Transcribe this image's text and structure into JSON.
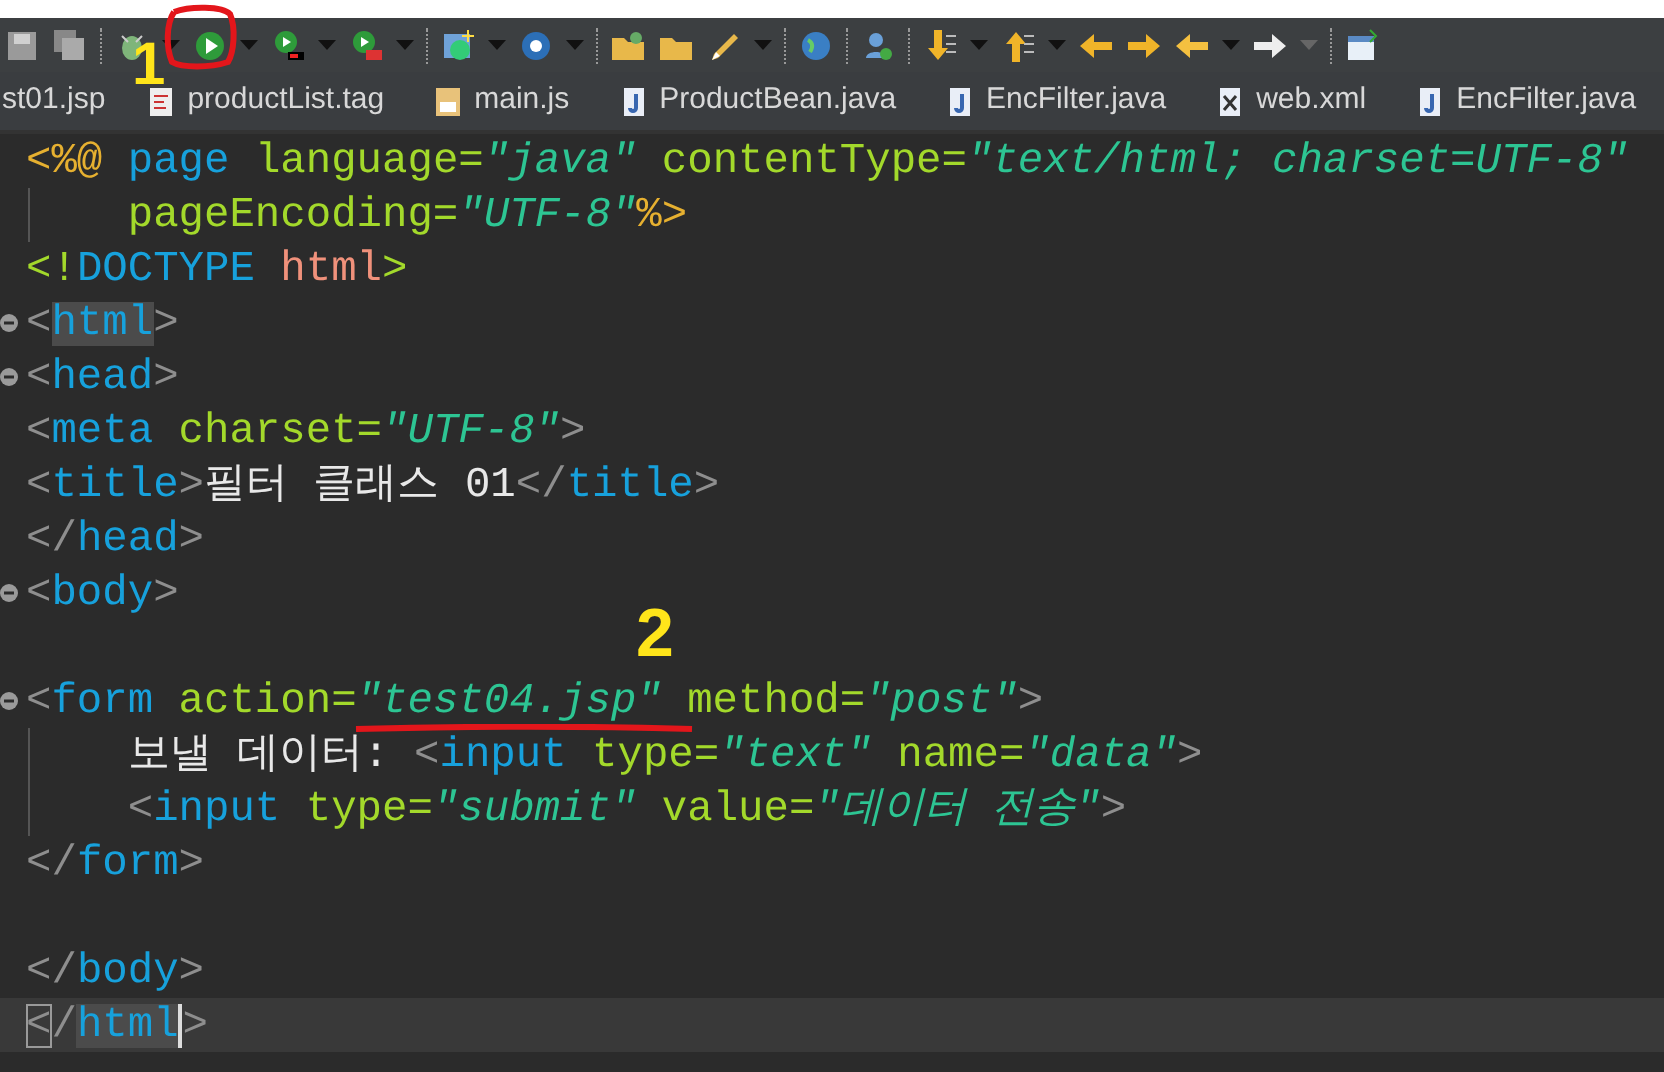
{
  "tabs": [
    {
      "label": "st01.jsp",
      "kind": "jsp"
    },
    {
      "label": "productList.tag",
      "kind": "tag"
    },
    {
      "label": "main.js",
      "kind": "js"
    },
    {
      "label": "ProductBean.java",
      "kind": "java"
    },
    {
      "label": "EncFilter.java",
      "kind": "java"
    },
    {
      "label": "web.xml",
      "kind": "xml"
    },
    {
      "label": "EncFilter.java",
      "kind": "java"
    }
  ],
  "editor": {
    "lines": [
      {
        "fold": false,
        "current": false,
        "tokens": [
          {
            "kind": "directive",
            "text": "<%@"
          },
          {
            "kind": "tag",
            "text": " page"
          },
          {
            "kind": "attr",
            "text": " language="
          },
          {
            "kind": "string",
            "text": "\"java\""
          },
          {
            "kind": "attr",
            "text": " contentType="
          },
          {
            "kind": "string",
            "text": "\"text/html; charset=UTF-8\""
          }
        ]
      },
      {
        "fold": false,
        "current": false,
        "tokens": [
          {
            "kind": "attr",
            "text": "    pageEncoding="
          },
          {
            "kind": "string",
            "text": "\"UTF-8\""
          },
          {
            "kind": "directive",
            "text": "%>"
          }
        ]
      },
      {
        "fold": false,
        "current": false,
        "tokens": [
          {
            "kind": "attr",
            "text": "<!"
          },
          {
            "kind": "tag",
            "text": "DOCTYPE"
          },
          {
            "kind": "root",
            "text": " html"
          },
          {
            "kind": "attr",
            "text": ">"
          }
        ]
      },
      {
        "fold": true,
        "current": false,
        "tokens": [
          {
            "kind": "punct",
            "text": "<"
          },
          {
            "kind": "tag",
            "text": "html",
            "highlighted": true
          },
          {
            "kind": "punct",
            "text": ">"
          }
        ]
      },
      {
        "fold": true,
        "current": false,
        "tokens": [
          {
            "kind": "punct",
            "text": "<"
          },
          {
            "kind": "tag",
            "text": "head"
          },
          {
            "kind": "punct",
            "text": ">"
          }
        ]
      },
      {
        "fold": false,
        "current": false,
        "tokens": [
          {
            "kind": "punct",
            "text": "<"
          },
          {
            "kind": "tag",
            "text": "meta"
          },
          {
            "kind": "attr",
            "text": " charset="
          },
          {
            "kind": "string",
            "text": "\"UTF-8\""
          },
          {
            "kind": "punct",
            "text": ">"
          }
        ]
      },
      {
        "fold": false,
        "current": false,
        "tokens": [
          {
            "kind": "punct",
            "text": "<"
          },
          {
            "kind": "tag",
            "text": "title"
          },
          {
            "kind": "punct",
            "text": ">"
          },
          {
            "kind": "text",
            "text": "필터 클래스 01"
          },
          {
            "kind": "punct",
            "text": "</"
          },
          {
            "kind": "tag",
            "text": "title"
          },
          {
            "kind": "punct",
            "text": ">"
          }
        ]
      },
      {
        "fold": false,
        "current": false,
        "tokens": [
          {
            "kind": "punct",
            "text": "</"
          },
          {
            "kind": "tag",
            "text": "head"
          },
          {
            "kind": "punct",
            "text": ">"
          }
        ]
      },
      {
        "fold": true,
        "current": false,
        "tokens": [
          {
            "kind": "punct",
            "text": "<"
          },
          {
            "kind": "tag",
            "text": "body"
          },
          {
            "kind": "punct",
            "text": ">"
          }
        ]
      },
      {
        "fold": true,
        "current": false,
        "blank_line_before": true,
        "tokens": [
          {
            "kind": "punct",
            "text": "<"
          },
          {
            "kind": "tag",
            "text": "form"
          },
          {
            "kind": "attr",
            "text": " action="
          },
          {
            "kind": "string",
            "text": "\"test04.jsp\""
          },
          {
            "kind": "attr",
            "text": " method="
          },
          {
            "kind": "string",
            "text": "\"post\""
          },
          {
            "kind": "punct",
            "text": ">"
          }
        ]
      },
      {
        "fold": false,
        "current": false,
        "tokens": [
          {
            "kind": "text",
            "text": "    보낼 데이터: "
          },
          {
            "kind": "punct",
            "text": "<"
          },
          {
            "kind": "tag",
            "text": "input"
          },
          {
            "kind": "attr",
            "text": " type="
          },
          {
            "kind": "string",
            "text": "\"text\""
          },
          {
            "kind": "attr",
            "text": " name="
          },
          {
            "kind": "string",
            "text": "\"data\""
          },
          {
            "kind": "punct",
            "text": ">"
          }
        ]
      },
      {
        "fold": false,
        "current": false,
        "tokens": [
          {
            "kind": "punct",
            "text": "    <"
          },
          {
            "kind": "tag",
            "text": "input"
          },
          {
            "kind": "attr",
            "text": " type="
          },
          {
            "kind": "string",
            "text": "\"submit\""
          },
          {
            "kind": "attr",
            "text": " value="
          },
          {
            "kind": "string",
            "text": "\"데이터 전송\""
          },
          {
            "kind": "punct",
            "text": ">"
          }
        ]
      },
      {
        "fold": false,
        "current": false,
        "tokens": [
          {
            "kind": "punct",
            "text": "</"
          },
          {
            "kind": "tag",
            "text": "form"
          },
          {
            "kind": "punct",
            "text": ">"
          }
        ]
      },
      {
        "fold": false,
        "current": false,
        "blank_line_before": true,
        "tokens": [
          {
            "kind": "punct",
            "text": "</"
          },
          {
            "kind": "tag",
            "text": "body"
          },
          {
            "kind": "punct",
            "text": ">"
          }
        ]
      },
      {
        "fold": false,
        "current": true,
        "tokens": [
          {
            "kind": "punct",
            "text": "<",
            "boxed": true
          },
          {
            "kind": "punct",
            "text": "/"
          },
          {
            "kind": "tag",
            "text": "html",
            "highlighted": true
          },
          {
            "kind": "punct",
            "text": ">"
          }
        ]
      }
    ]
  },
  "annotations": [
    {
      "text": "1"
    },
    {
      "text": "2"
    }
  ]
}
